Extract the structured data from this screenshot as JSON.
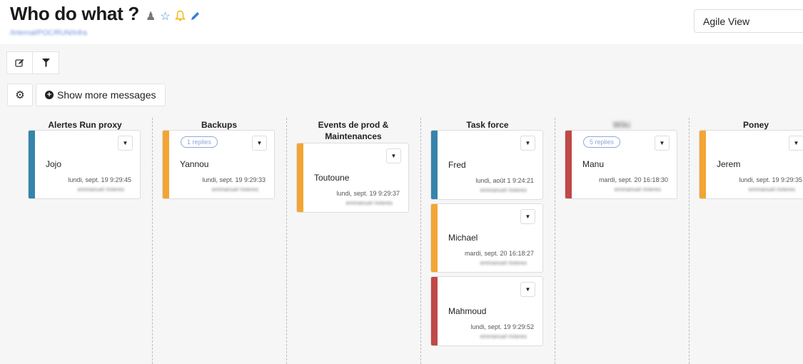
{
  "header": {
    "title": "Who do what ?",
    "breadcrumb": "/Internal/POC/RUN/Infra",
    "icons": [
      {
        "name": "user-icon",
        "glyph": "♙",
        "color": "#777777"
      },
      {
        "name": "star-icon",
        "glyph": "☆",
        "color": "#3a8fd8"
      },
      {
        "name": "bell-icon",
        "glyph": "🔔",
        "color": "#f5b400"
      },
      {
        "name": "pencil-icon",
        "glyph": "✎",
        "color": "#3a7fd0"
      }
    ],
    "view_select": "Agile View"
  },
  "toolbar": {
    "edit_icon": "✎",
    "filter_icon": "▼",
    "settings_icon": "⚙",
    "show_more_label": "Show more messages"
  },
  "colors": {
    "blue": "#3584ab",
    "orange": "#f3a534",
    "red": "#c04848"
  },
  "columns": [
    {
      "title": "Alertes Run proxy",
      "blurred": false,
      "cards": [
        {
          "name": "Jojo",
          "date": "lundi, sept. 19 9:29:45",
          "author": "emmanuel rivieres",
          "replies": "",
          "color": "blue"
        }
      ]
    },
    {
      "title": "Backups",
      "blurred": false,
      "cards": [
        {
          "name": "Yannou",
          "date": "lundi, sept. 19 9:29:33",
          "author": "emmanuel rivieres",
          "replies": "1 replies",
          "color": "orange"
        }
      ]
    },
    {
      "title": "Events de prod & Maintenances",
      "blurred": false,
      "cards": [
        {
          "name": "Toutoune",
          "date": "lundi, sept. 19 9:29:37",
          "author": "emmanuel rivieres",
          "replies": "",
          "color": "orange"
        }
      ]
    },
    {
      "title": "Task force",
      "blurred": false,
      "cards": [
        {
          "name": "Fred",
          "date": "lundi, août 1 9:24:21",
          "author": "emmanuel rivieres",
          "replies": "",
          "color": "blue"
        },
        {
          "name": "Michael",
          "date": "mardi, sept. 20 16:18:27",
          "author": "emmanuel rivieres",
          "replies": "",
          "color": "orange"
        },
        {
          "name": "Mahmoud",
          "date": "lundi, sept. 19 9:29:52",
          "author": "emmanuel rivieres",
          "replies": "",
          "color": "red"
        }
      ]
    },
    {
      "title": "Wiki",
      "blurred": true,
      "cards": [
        {
          "name": "Manu",
          "date": "mardi, sept. 20 16:18:30",
          "author": "emmanuel rivieres",
          "replies": "5 replies",
          "color": "red"
        }
      ]
    },
    {
      "title": "Poney",
      "blurred": false,
      "cards": [
        {
          "name": "Jerem",
          "date": "lundi, sept. 19 9:29:35",
          "author": "emmanuel rivieres",
          "replies": "",
          "color": "orange"
        }
      ]
    }
  ]
}
